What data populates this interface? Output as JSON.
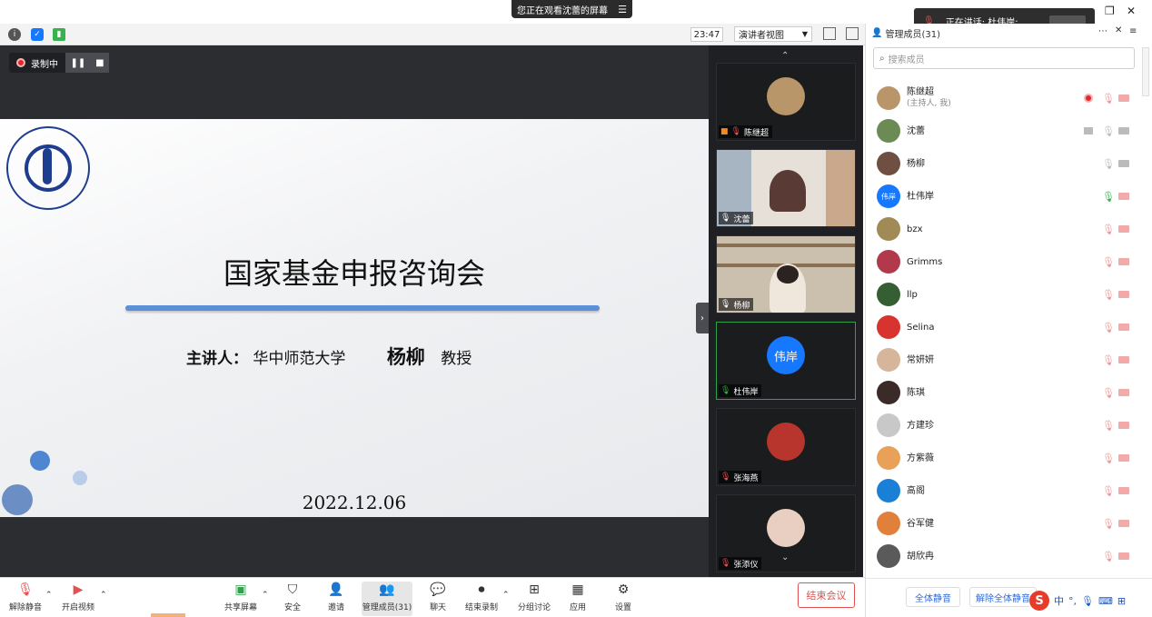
{
  "share_banner": {
    "text": "您正在观看沈蕾的屏幕",
    "menu_icon": "menu-icon"
  },
  "toolbar": {
    "clock": "23:47",
    "view_button": "演讲者视图",
    "icons": [
      "info-icon",
      "shield-icon",
      "signal-icon"
    ]
  },
  "speaking_popup": {
    "text": "正在讲话: 杜伟岸;"
  },
  "recording": {
    "label": "录制中"
  },
  "slide": {
    "title": "国家基金申报咨询会",
    "speaker_label": "主讲人：",
    "speaker_org": "华中师范大学",
    "speaker_name": "杨柳",
    "speaker_title": "教授",
    "date": "2022.12.06",
    "seal_text": "SCHOOL OF ECONOMICS WUT"
  },
  "video_tiles": [
    {
      "name": "陈继超",
      "mic": "muted",
      "colors": {
        "bg": "#1b1c1e",
        "avatar": "#b9956a"
      }
    },
    {
      "name": "沈蕾",
      "mic": "on",
      "colors": {
        "bg": "#d9d2c8",
        "avatar": "#5a3a35"
      }
    },
    {
      "name": "杨柳",
      "mic": "on",
      "colors": {
        "bg": "#cbbfae",
        "avatar": "#2b2320"
      }
    },
    {
      "name": "杜伟岸",
      "mic": "speaking",
      "avatar_text": "伟岸",
      "colors": {
        "bg": "#1b1c1e",
        "avatar": "#1677ff"
      }
    },
    {
      "name": "张海燕",
      "mic": "muted",
      "colors": {
        "bg": "#1b1c1e",
        "avatar": "#b8352e"
      }
    },
    {
      "name": "张添仪",
      "mic": "muted",
      "colors": {
        "bg": "#1b1c1e",
        "avatar": "#e9cfc1"
      }
    }
  ],
  "panel": {
    "title": "管理成员(31)",
    "search_placeholder": "搜索成员",
    "members": [
      {
        "name": "陈继超",
        "sub": "(主持人, 我)",
        "status": "rec",
        "mic": "muted",
        "cam": "off",
        "avatar_color": "#b9956a"
      },
      {
        "name": "沈蕾",
        "sub": "",
        "status": "screen",
        "mic": "idle",
        "cam": "idle",
        "avatar_color": "#6c8a54"
      },
      {
        "name": "杨柳",
        "sub": "",
        "status": "",
        "mic": "idle",
        "cam": "idle",
        "avatar_color": "#6e4f42"
      },
      {
        "name": "杜伟岸",
        "sub": "",
        "status": "",
        "mic": "on",
        "cam": "off",
        "avatar_color": "#1677ff",
        "avatar_text": "伟岸"
      },
      {
        "name": "bzx",
        "sub": "",
        "status": "",
        "mic": "muted",
        "cam": "off",
        "avatar_color": "#a08a55"
      },
      {
        "name": "Grimms",
        "sub": "",
        "status": "",
        "mic": "muted",
        "cam": "off",
        "avatar_color": "#b2394c"
      },
      {
        "name": "llp",
        "sub": "",
        "status": "",
        "mic": "muted",
        "cam": "off",
        "avatar_color": "#355e33"
      },
      {
        "name": "Selina",
        "sub": "",
        "status": "",
        "mic": "muted",
        "cam": "off",
        "avatar_color": "#d9332f"
      },
      {
        "name": "常妍妍",
        "sub": "",
        "status": "",
        "mic": "muted",
        "cam": "off",
        "avatar_color": "#d7b59b"
      },
      {
        "name": "陈琪",
        "sub": "",
        "status": "",
        "mic": "muted",
        "cam": "off",
        "avatar_color": "#3a2a28"
      },
      {
        "name": "方建珍",
        "sub": "",
        "status": "",
        "mic": "muted",
        "cam": "off",
        "avatar_color": "#c8c8c8"
      },
      {
        "name": "方紫薇",
        "sub": "",
        "status": "",
        "mic": "muted",
        "cam": "off",
        "avatar_color": "#e9a15a"
      },
      {
        "name": "高阁",
        "sub": "",
        "status": "",
        "mic": "muted",
        "cam": "off",
        "avatar_color": "#1a7fd6"
      },
      {
        "name": "谷军健",
        "sub": "",
        "status": "",
        "mic": "muted",
        "cam": "off",
        "avatar_color": "#e0803b"
      },
      {
        "name": "胡欣冉",
        "sub": "",
        "status": "",
        "mic": "muted",
        "cam": "off",
        "avatar_color": "#5a5a5a"
      }
    ],
    "footer": {
      "mute_all": "全体静音",
      "unmute_all": "解除全体静音",
      "ime_label": "中"
    }
  },
  "bottombar": {
    "items": [
      {
        "label": "解除静音",
        "icon": "mic-muted-icon"
      },
      {
        "label": "开启视频",
        "icon": "camera-off-icon"
      },
      {
        "label": "共享屏幕",
        "icon": "share-screen-icon"
      },
      {
        "label": "安全",
        "icon": "shield-icon"
      },
      {
        "label": "邀请",
        "icon": "invite-icon"
      },
      {
        "label": "管理成员(31)",
        "icon": "members-icon"
      },
      {
        "label": "聊天",
        "icon": "chat-icon"
      },
      {
        "label": "结束录制",
        "icon": "stop-record-icon"
      },
      {
        "label": "分组讨论",
        "icon": "breakout-icon"
      },
      {
        "label": "应用",
        "icon": "apps-icon"
      },
      {
        "label": "设置",
        "icon": "settings-icon"
      }
    ],
    "end_meeting": "结束会议"
  },
  "colors": {
    "stage": "#2b2d31",
    "accent": "#1677ff",
    "danger": "#e05151",
    "speaking": "#2fa24b"
  }
}
